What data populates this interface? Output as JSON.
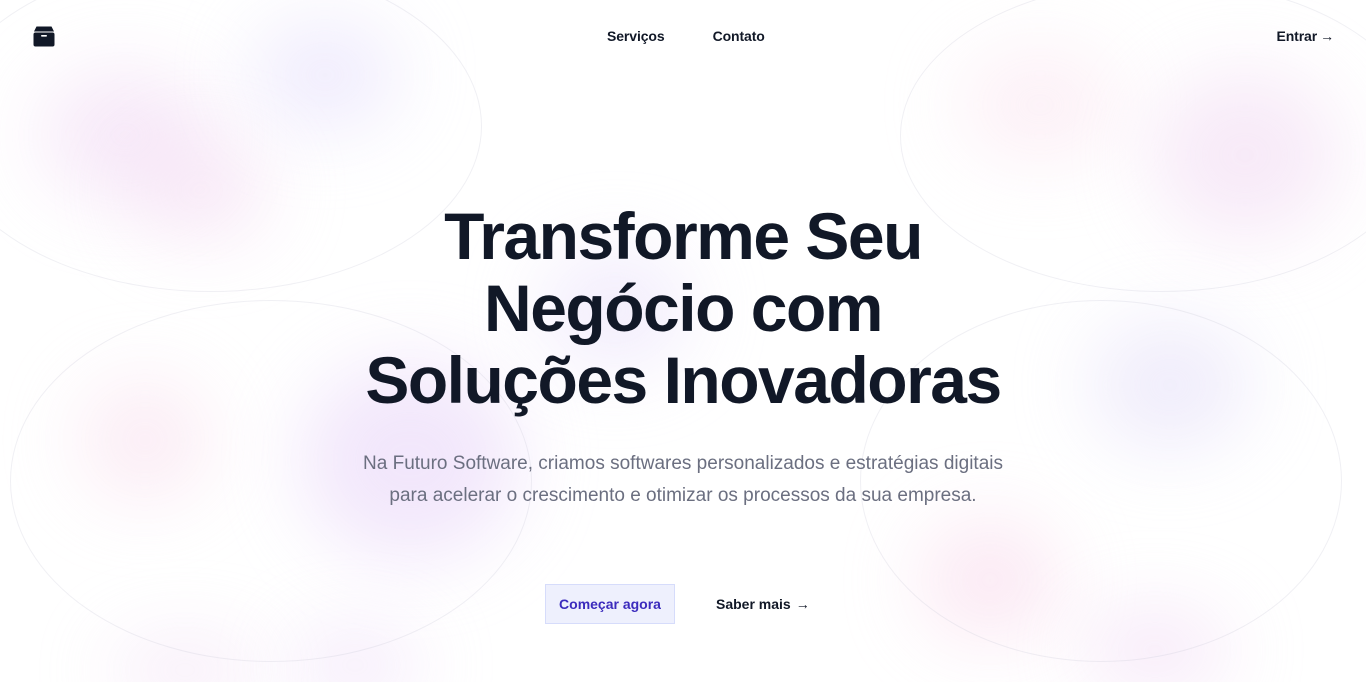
{
  "header": {
    "logo_icon": "box-icon",
    "nav": [
      {
        "label": "Serviços"
      },
      {
        "label": "Contato"
      }
    ],
    "login": {
      "label": "Entrar",
      "icon": "arrow-right-icon"
    }
  },
  "hero": {
    "title_lines": [
      "Transforme Seu",
      "Negócio com",
      "Soluções Inovadoras"
    ],
    "subtitle": "Na Futuro Software, criamos softwares personalizados e estratégias digitais para acelerar o crescimento e otimizar os processos da sua empresa.",
    "primary_button": "Começar agora",
    "secondary_button": {
      "label": "Saber mais",
      "icon": "arrow-right-icon"
    }
  },
  "colors": {
    "text": "#111827",
    "muted": "#6b6f80",
    "accent": "#3b2bbd",
    "accent_bg": "#eef0fd"
  }
}
